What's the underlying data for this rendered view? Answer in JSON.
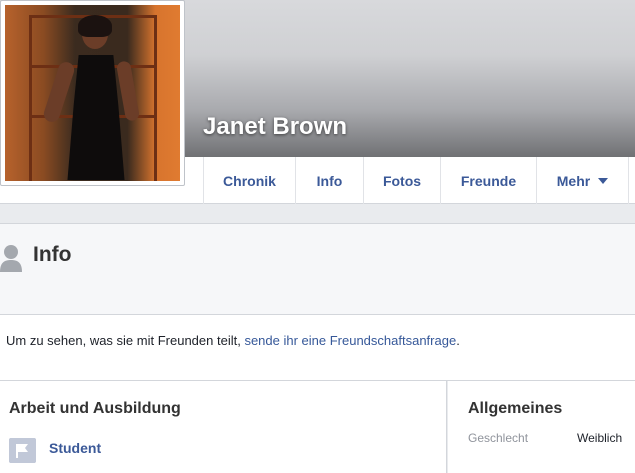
{
  "profile": {
    "name": "Janet Brown"
  },
  "nav": {
    "tabs": [
      {
        "label": "Chronik"
      },
      {
        "label": "Info"
      },
      {
        "label": "Fotos"
      },
      {
        "label": "Freunde"
      },
      {
        "label": "Mehr"
      }
    ]
  },
  "info_section": {
    "title": "Info",
    "icon": "person-silhouette-icon"
  },
  "friend_request": {
    "text": "Um zu sehen, was sie mit Freunden teilt, ",
    "link": "sende ihr eine Freundschaftsanfrage",
    "suffix": "."
  },
  "work_education": {
    "title": "Arbeit und Ausbildung",
    "items": [
      {
        "label": "Student",
        "icon": "flag-icon"
      }
    ]
  },
  "general": {
    "title": "Allgemeines",
    "fields": [
      {
        "label": "Geschlecht",
        "value": "Weiblich"
      }
    ]
  },
  "colors": {
    "link": "#3b5998",
    "background": "#e9ebee",
    "heading": "#333333"
  }
}
